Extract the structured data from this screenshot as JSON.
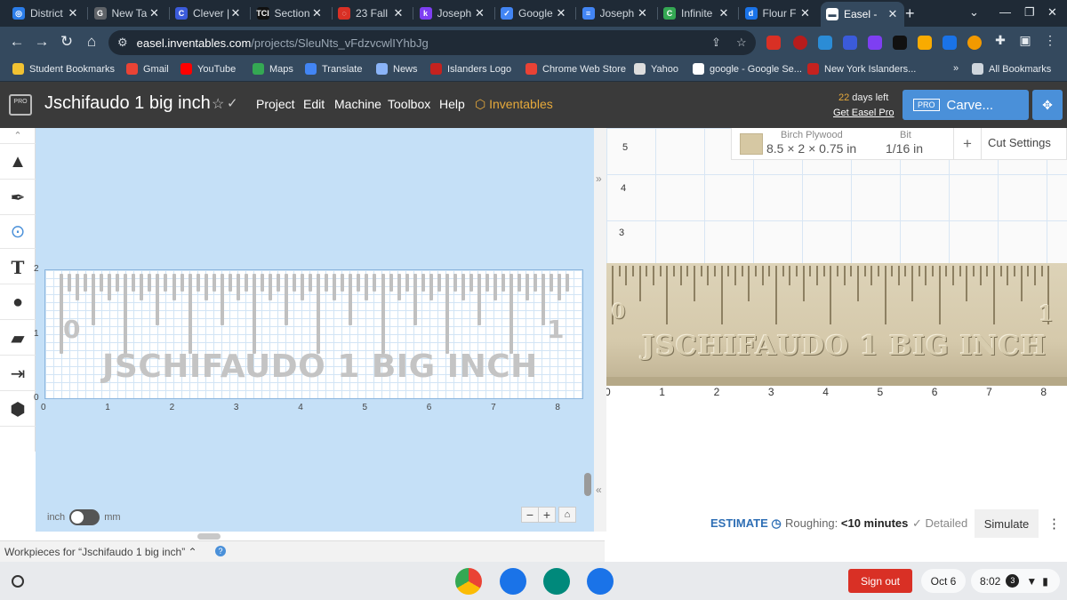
{
  "browser": {
    "tabs": [
      {
        "title": "District",
        "color": "#2b7de9",
        "glyph": "◎"
      },
      {
        "title": "New Ta",
        "color": "#5f6368",
        "glyph": "G"
      },
      {
        "title": "Clever |",
        "color": "#3b5bdb",
        "glyph": "C"
      },
      {
        "title": "Section",
        "color": "#111111",
        "glyph": "TCI"
      },
      {
        "title": "23 Fall",
        "color": "#d93025",
        "glyph": "◌"
      },
      {
        "title": "Joseph",
        "color": "#7e3ff2",
        "glyph": "k"
      },
      {
        "title": "Google",
        "color": "#4285f4",
        "glyph": "✓"
      },
      {
        "title": "Joseph",
        "color": "#4285f4",
        "glyph": "≡"
      },
      {
        "title": "Infinite",
        "color": "#34a853",
        "glyph": "C"
      },
      {
        "title": "Flour F",
        "color": "#1a73e8",
        "glyph": "d"
      },
      {
        "title": "Easel -",
        "color": "#ffffff",
        "glyph": "▬"
      }
    ],
    "url_host": "easel.inventables.com",
    "url_path": "/projects/SleuNts_vFdzvcwlIYhbJg",
    "bookmarks": [
      {
        "label": "Student Bookmarks",
        "color": "#f1c232"
      },
      {
        "label": "Gmail",
        "color": "#ea4335"
      },
      {
        "label": "YouTube",
        "color": "#ff0000"
      },
      {
        "label": "Maps",
        "color": "#34a853"
      },
      {
        "label": "Translate",
        "color": "#4285f4"
      },
      {
        "label": "News",
        "color": "#8ab4f8"
      },
      {
        "label": "Islanders Logo",
        "color": "#c5221f"
      },
      {
        "label": "Chrome Web Store",
        "color": "#e94235"
      },
      {
        "label": "Yahoo",
        "color": "#dddddd"
      },
      {
        "label": "google - Google Se...",
        "color": "#ffffff"
      },
      {
        "label": "New York Islanders...",
        "color": "#c5221f"
      }
    ],
    "all_bookmarks": "All Bookmarks",
    "more_bookmarks": "»"
  },
  "easel": {
    "pro_logo": "PRO",
    "project_title": "Jschifaudo 1 big inch",
    "menu": [
      "Project",
      "Edit",
      "Machine",
      "Toolbox",
      "Help"
    ],
    "inventables": "Inventables",
    "trial_days_num": "22",
    "trial_days_text": " days left",
    "get_pro": "Get Easel Pro",
    "carve_pro_badge": "PRO",
    "carve_label": "Carve..."
  },
  "design": {
    "workpiece_text": "JSCHIFAUDO 1 BIG INCH",
    "left_num": "0",
    "right_num": "1",
    "x_ruler": [
      "0",
      "1",
      "2",
      "3",
      "4",
      "5",
      "6",
      "7",
      "8"
    ],
    "y_ruler": [
      "2",
      "1",
      "0"
    ],
    "unit_inch": "inch",
    "unit_mm": "mm"
  },
  "preview": {
    "material_name": "Birch Plywood",
    "material_size": "8.5 × 2 × 0.75 in",
    "bit_label": "Bit",
    "bit_size": "1/16 in",
    "cut_settings": "Cut Settings",
    "y_labels": [
      "5",
      "4",
      "3"
    ],
    "x_labels": [
      "0",
      "1",
      "2",
      "3",
      "4",
      "5",
      "6",
      "7",
      "8"
    ],
    "stock_text": "JSCHIFAUDO 1 BIG INCH",
    "stock_left": "0",
    "stock_right": "1"
  },
  "estimate": {
    "link": "ESTIMATE",
    "roughing_label": "Roughing: ",
    "roughing_value": "<10 minutes",
    "detailed": "Detailed",
    "simulate": "Simulate"
  },
  "workpieces": {
    "title": "Workpieces for “Jschifaudo 1 big inch”"
  },
  "shelf": {
    "sign_out": "Sign out",
    "date": "Oct 6",
    "time": "8:02",
    "notifications": "3"
  }
}
